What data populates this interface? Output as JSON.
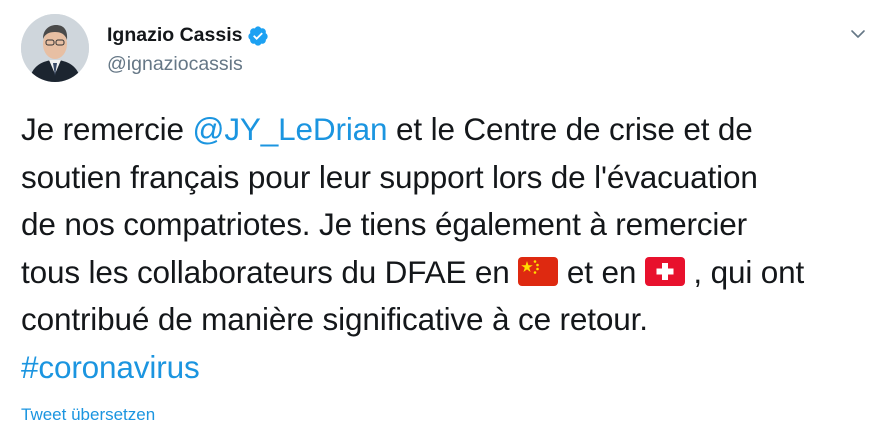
{
  "author": {
    "display_name": "Ignazio Cassis",
    "handle": "@ignaziocassis",
    "verified": true
  },
  "tweet": {
    "line1_pre": "Je remercie ",
    "mention": "@JY_LeDrian",
    "line1_post": " et le Centre de crise et de",
    "line2": "soutien français pour leur support lors de l'évacuation",
    "line3": "de nos compatriotes. Je tiens également à remercier",
    "line4_pre": "tous les collaborateurs du DFAE en ",
    "flag1": "china-flag",
    "line4_mid": " et en ",
    "flag2": "switzerland-flag",
    "line4_post": " , qui ont",
    "line5": "contribué de manière significative à ce retour.",
    "hashtag": "#coronavirus"
  },
  "translate_label": "Tweet übersetzen",
  "icons": {
    "verified": "verified-badge-icon",
    "caret": "chevron-down-icon"
  },
  "colors": {
    "link": "#1b95e0",
    "text": "#14171a",
    "secondary": "#657786",
    "verified": "#1da1f2"
  }
}
